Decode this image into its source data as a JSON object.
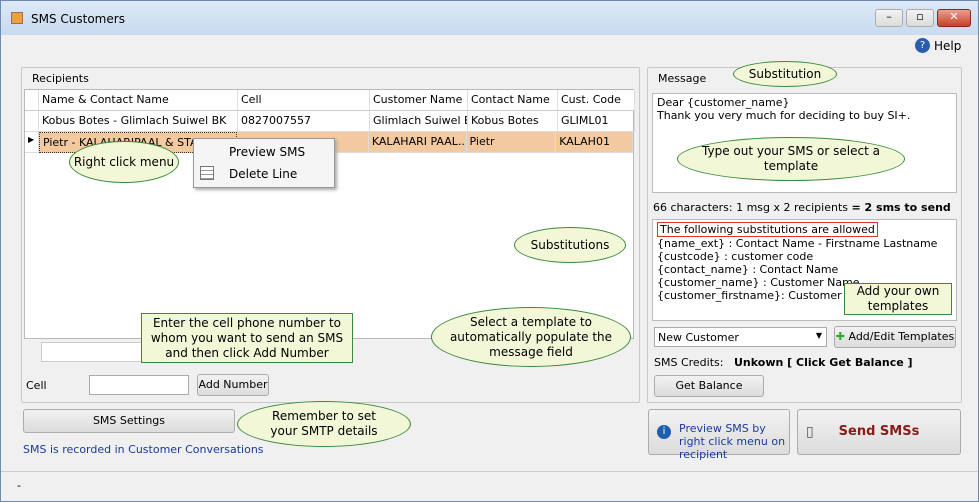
{
  "window": {
    "title": "SMS Customers",
    "help": "Help"
  },
  "recipients": {
    "label": "Recipients",
    "columns": [
      "Name  & Contact Name",
      "Cell",
      "Customer Name",
      "Contact Name",
      "Cust. Code"
    ],
    "rows": [
      [
        "Kobus  Botes - Glimlach Suiwel BK",
        "0827007557",
        "Glimlach Suiwel BK",
        "Kobus  Botes",
        "GLIML01"
      ],
      [
        "Pietr - KALAHARIPAAL & STAAL",
        "",
        "KALAHARI PAAL...",
        "Pietr",
        "KALAH01"
      ]
    ],
    "selected_row_color": "#f3c99f"
  },
  "context_menu": {
    "items": [
      "Preview SMS",
      "Delete Line"
    ]
  },
  "cell_input": {
    "label": "Cell",
    "value": "",
    "add_button": "Add Number"
  },
  "sms_settings_button": "SMS Settings",
  "footer_note": "SMS is recorded in Customer Conversations",
  "message": {
    "label": "Message",
    "text": "Dear {customer_name}\nThank you very much for deciding to buy SI+.",
    "count_prefix": "66 characters: 1 msg x 2 recipients ",
    "count_bold": "= 2 sms to send",
    "substitutions": [
      "The following substitutions are allowed",
      "{name_ext} : Contact Name - Firstname Lastname",
      "{custcode} : customer code",
      "{contact_name} : Contact Name",
      "{customer_name} : Customer Name",
      "{customer_firstname}: Customer Firstname"
    ],
    "template": "New Customer",
    "add_edit_templates": "Add/Edit Templates",
    "credits_label": "SMS Credits:",
    "credits_value": "Unkown [ Click Get Balance ]",
    "get_balance": "Get Balance"
  },
  "preview_hint": "Preview SMS by right click menu on recipient",
  "send_button": "Send SMSs",
  "status": "-",
  "callouts": {
    "substitution": "Substitution",
    "right_click": "Right click menu",
    "type_sms": "Type out your SMS or select a template",
    "substitutions": "Substitutions",
    "own_templates": "Add your own templates",
    "select_template": "Select a template to automatically populate the message field",
    "enter_cell": "Enter the cell phone number to whom you want to send an SMS and then click Add Number",
    "smtp": "Remember to set your SMTP details"
  }
}
